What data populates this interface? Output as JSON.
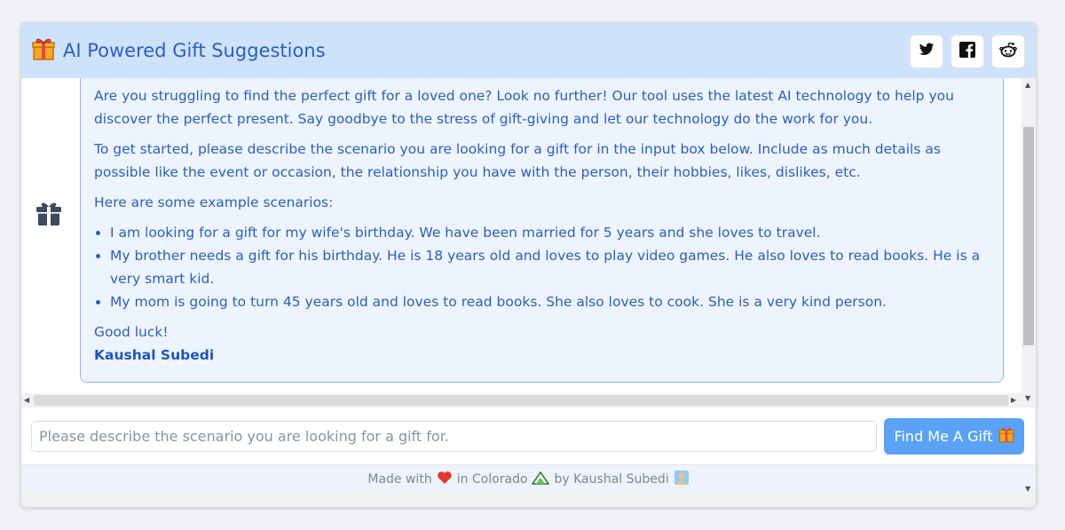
{
  "header": {
    "title": "AI Powered Gift Suggestions",
    "title_icon": "gift-icon",
    "social": [
      {
        "name": "twitter-icon"
      },
      {
        "name": "facebook-icon"
      },
      {
        "name": "reddit-icon"
      }
    ]
  },
  "message": {
    "avatar_icon": "gift-icon",
    "paragraph1": "Are you struggling to find the perfect gift for a loved one? Look no further! Our tool uses the latest AI technology to help you discover the perfect present. Say goodbye to the stress of gift-giving and let our technology do the work for you.",
    "paragraph2": "To get started, please describe the scenario you are looking for a gift for in the input box below. Include as much details as possible like the event or occasion, the relationship you have with the person, their hobbies, likes, dislikes, etc.",
    "examples_heading": "Here are some example scenarios:",
    "examples": [
      "I am looking for a gift for my wife's birthday. We have been married for 5 years and she loves to travel.",
      "My brother needs a gift for his birthday. He is 18 years old and loves to play video games. He also loves to read books. He is a very smart kid.",
      "My mom is going to turn 45 years old and loves to read books. She also loves to cook. She is a very kind person."
    ],
    "closing": "Good luck!",
    "author": "Kaushal Subedi"
  },
  "input": {
    "placeholder": "Please describe the scenario you are looking for a gift for.",
    "value": ""
  },
  "button": {
    "label": "Find Me A Gift",
    "icon": "gift-icon"
  },
  "footer": {
    "made_with": "Made with",
    "in_place": "in Colorado",
    "by": "by Kaushal Subedi",
    "icons": [
      "heart-icon",
      "mountain-icon",
      "person-icon"
    ]
  },
  "colors": {
    "header_bg": "#cfe2fc",
    "accent": "#2a5fbf",
    "button_bg": "#5aa2f5",
    "bubble_bg": "#eef4ff",
    "bubble_border": "#8fb5ec"
  }
}
